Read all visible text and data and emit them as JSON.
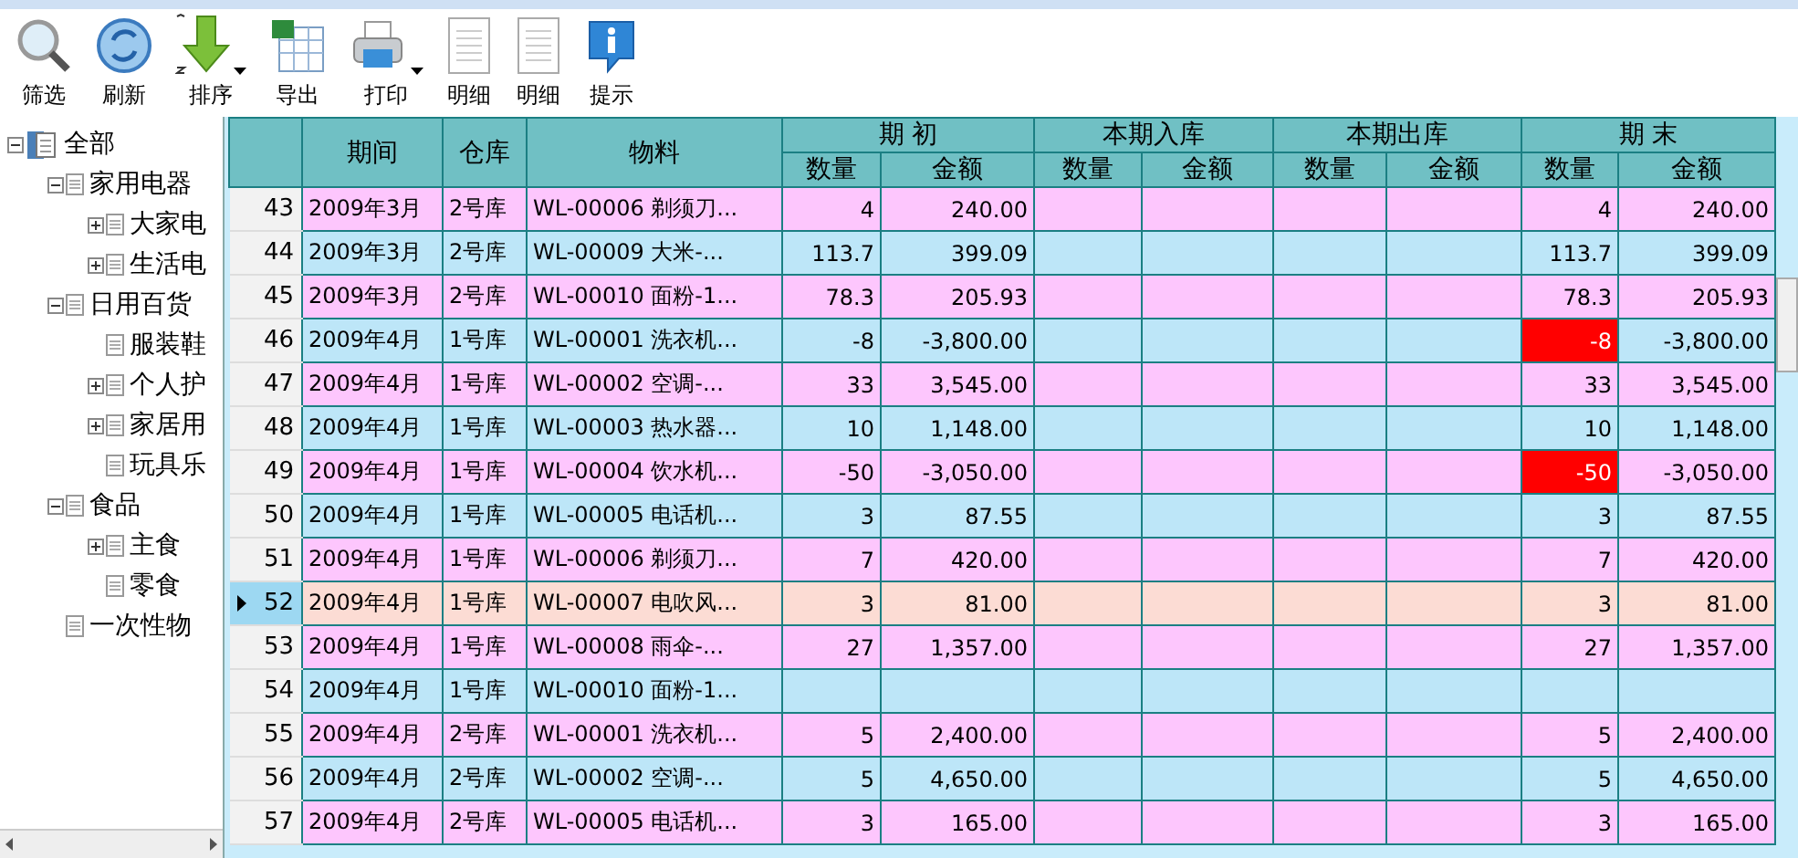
{
  "toolbar": [
    {
      "label": "筛选",
      "dropdown": false
    },
    {
      "label": "刷新",
      "dropdown": false
    },
    {
      "label": "排序",
      "dropdown": true
    },
    {
      "label": "导出",
      "dropdown": false
    },
    {
      "label": "打印",
      "dropdown": true
    },
    {
      "label": "明细",
      "dropdown": false
    },
    {
      "label": "明细",
      "dropdown": false
    },
    {
      "label": "提示",
      "dropdown": false
    }
  ],
  "tree": [
    {
      "label": "全部",
      "expanded": true,
      "children": [
        {
          "label": "家用电器",
          "expanded": true,
          "children": [
            {
              "label": "大家电",
              "expanded": false
            },
            {
              "label": "生活电",
              "expanded": false
            }
          ]
        },
        {
          "label": "日用百货",
          "expanded": true,
          "children": [
            {
              "label": "服装鞋"
            },
            {
              "label": "个人护",
              "expanded": false
            },
            {
              "label": "家居用",
              "expanded": false
            },
            {
              "label": "玩具乐"
            }
          ]
        },
        {
          "label": "食品",
          "expanded": true,
          "children": [
            {
              "label": "主食",
              "expanded": false
            },
            {
              "label": "零食"
            }
          ]
        },
        {
          "label": "一次性物"
        }
      ]
    }
  ],
  "table": {
    "columns": [
      "期间",
      "仓库",
      "物料"
    ],
    "groups": [
      {
        "label": "期 初",
        "columns": [
          "数量",
          "金额"
        ]
      },
      {
        "label": "本期入库",
        "columns": [
          "数量",
          "金额"
        ]
      },
      {
        "label": "本期出库",
        "columns": [
          "数量",
          "金额"
        ]
      },
      {
        "label": "期 末",
        "columns": [
          "数量",
          "金额"
        ]
      }
    ],
    "rows": [
      {
        "num": "43",
        "selected": false,
        "cells": [
          "2009年3月",
          "2号库",
          "WL-00006 剃须刀..."
        ],
        "open_qty": "4",
        "open_amt": "240.00",
        "end_qty": "4",
        "end_amt": "240.00",
        "end_alert": false
      },
      {
        "num": "44",
        "selected": false,
        "cells": [
          "2009年3月",
          "2号库",
          "WL-00009 大米-..."
        ],
        "open_qty": "113.7",
        "open_amt": "399.09",
        "end_qty": "113.7",
        "end_amt": "399.09",
        "end_alert": false
      },
      {
        "num": "45",
        "selected": false,
        "cells": [
          "2009年3月",
          "2号库",
          "WL-00010 面粉-1..."
        ],
        "open_qty": "78.3",
        "open_amt": "205.93",
        "end_qty": "78.3",
        "end_amt": "205.93",
        "end_alert": false
      },
      {
        "num": "46",
        "selected": false,
        "cells": [
          "2009年4月",
          "1号库",
          "WL-00001 洗衣机..."
        ],
        "open_qty": "-8",
        "open_amt": "-3,800.00",
        "end_qty": "-8",
        "end_amt": "-3,800.00",
        "end_alert": true
      },
      {
        "num": "47",
        "selected": false,
        "cells": [
          "2009年4月",
          "1号库",
          "WL-00002 空调-..."
        ],
        "open_qty": "33",
        "open_amt": "3,545.00",
        "end_qty": "33",
        "end_amt": "3,545.00",
        "end_alert": false
      },
      {
        "num": "48",
        "selected": false,
        "cells": [
          "2009年4月",
          "1号库",
          "WL-00003 热水器..."
        ],
        "open_qty": "10",
        "open_amt": "1,148.00",
        "end_qty": "10",
        "end_amt": "1,148.00",
        "end_alert": false
      },
      {
        "num": "49",
        "selected": false,
        "cells": [
          "2009年4月",
          "1号库",
          "WL-00004 饮水机..."
        ],
        "open_qty": "-50",
        "open_amt": "-3,050.00",
        "end_qty": "-50",
        "end_amt": "-3,050.00",
        "end_alert": true
      },
      {
        "num": "50",
        "selected": false,
        "cells": [
          "2009年4月",
          "1号库",
          "WL-00005 电话机..."
        ],
        "open_qty": "3",
        "open_amt": "87.55",
        "end_qty": "3",
        "end_amt": "87.55",
        "end_alert": false
      },
      {
        "num": "51",
        "selected": false,
        "cells": [
          "2009年4月",
          "1号库",
          "WL-00006 剃须刀..."
        ],
        "open_qty": "7",
        "open_amt": "420.00",
        "end_qty": "7",
        "end_amt": "420.00",
        "end_alert": false
      },
      {
        "num": "52",
        "selected": true,
        "cells": [
          "2009年4月",
          "1号库",
          "WL-00007 电吹风..."
        ],
        "open_qty": "3",
        "open_amt": "81.00",
        "end_qty": "3",
        "end_amt": "81.00",
        "end_alert": false
      },
      {
        "num": "53",
        "selected": false,
        "cells": [
          "2009年4月",
          "1号库",
          "WL-00008 雨伞-..."
        ],
        "open_qty": "27",
        "open_amt": "1,357.00",
        "end_qty": "27",
        "end_amt": "1,357.00",
        "end_alert": false
      },
      {
        "num": "54",
        "selected": false,
        "cells": [
          "2009年4月",
          "1号库",
          "WL-00010 面粉-1..."
        ],
        "end_alert": false
      },
      {
        "num": "55",
        "selected": false,
        "cells": [
          "2009年4月",
          "2号库",
          "WL-00001 洗衣机..."
        ],
        "open_qty": "5",
        "open_amt": "2,400.00",
        "end_qty": "5",
        "end_amt": "2,400.00",
        "end_alert": false
      },
      {
        "num": "56",
        "selected": false,
        "cells": [
          "2009年4月",
          "2号库",
          "WL-00002 空调-..."
        ],
        "open_qty": "5",
        "open_amt": "4,650.00",
        "end_qty": "5",
        "end_amt": "4,650.00",
        "end_alert": false
      },
      {
        "num": "57",
        "selected": false,
        "cells": [
          "2009年4月",
          "2号库",
          "WL-00005 电话机..."
        ],
        "open_qty": "3",
        "open_amt": "165.00",
        "end_qty": "3",
        "end_amt": "165.00",
        "end_alert": false
      }
    ]
  }
}
